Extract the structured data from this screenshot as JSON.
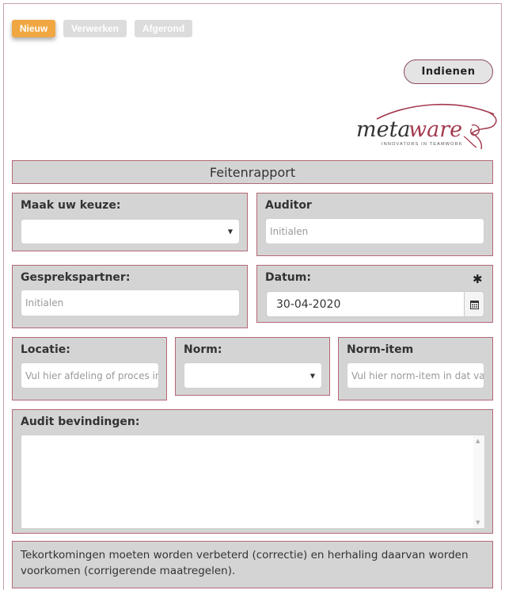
{
  "status_tabs": [
    {
      "label": "Nieuw",
      "active": true
    },
    {
      "label": "Verwerken",
      "active": false
    },
    {
      "label": "Afgerond",
      "active": false
    }
  ],
  "submit_label": "Indienen",
  "logo": {
    "brand": "metaware",
    "tagline": "INNOVATORS IN TEAMWORK"
  },
  "form_title": "Feitenrapport",
  "fields": {
    "choice": {
      "label": "Maak uw keuze:",
      "value": ""
    },
    "auditor": {
      "label": "Auditor",
      "placeholder": "Initialen"
    },
    "partner": {
      "label": "Gesprekspartner:",
      "placeholder": "Initialen"
    },
    "date": {
      "label": "Datum:",
      "value": "30-04-2020",
      "required_mark": "✱"
    },
    "location": {
      "label": "Locatie:",
      "placeholder": "Vul hier afdeling of proces in"
    },
    "norm": {
      "label": "Norm:",
      "value": ""
    },
    "norm_item": {
      "label": "Norm-item",
      "placeholder": "Vul hier norm-item in dat van toepassing is"
    },
    "findings": {
      "label": "Audit bevindingen:",
      "value": ""
    }
  },
  "note_text": "Tekortkomingen moeten worden verbeterd (correctie) en herhaling daarvan worden voorkomen (corrigerende maatregelen).",
  "colors": {
    "accent": "#f0a742",
    "panel": "#d4d4d4",
    "border": "#b56877",
    "brand": "#a33a4e"
  }
}
